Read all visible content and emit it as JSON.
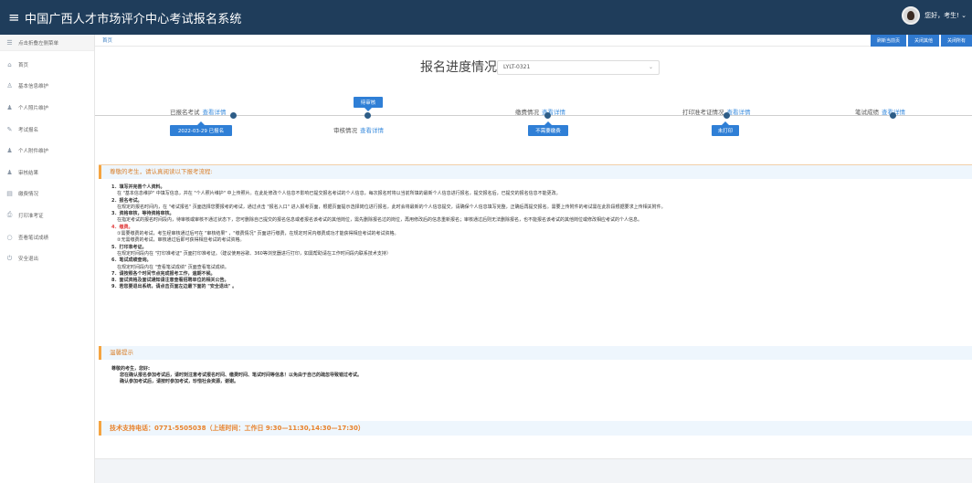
{
  "app": {
    "title": "中国广西人才市场评介中心考试报名系统",
    "menu_icon": "hamburger-icon"
  },
  "user": {
    "greeting": "您好，考生! ⌄"
  },
  "sidebar": {
    "items": [
      {
        "label": "点击折叠左侧菜单",
        "icon": "menu-icon",
        "glyph": "☰"
      },
      {
        "label": "首页",
        "icon": "home-icon",
        "glyph": "⌂"
      },
      {
        "label": "基本信息维护",
        "icon": "user-icon",
        "glyph": "♙"
      },
      {
        "label": "个人照片维护",
        "icon": "person-icon",
        "glyph": "♟"
      },
      {
        "label": "考试报名",
        "icon": "edit-icon",
        "glyph": "✎"
      },
      {
        "label": "个人附件维护",
        "icon": "attachment-icon",
        "glyph": "♟"
      },
      {
        "label": "审核结果",
        "icon": "review-icon",
        "glyph": "♟"
      },
      {
        "label": "缴费情况",
        "icon": "payment-icon",
        "glyph": "▤"
      },
      {
        "label": "打印准考证",
        "icon": "print-icon",
        "glyph": "⎙"
      },
      {
        "label": "查看笔试成绩",
        "icon": "search-icon",
        "glyph": "○"
      },
      {
        "label": "安全退出",
        "icon": "power-icon",
        "glyph": "⏻"
      }
    ]
  },
  "tabs": {
    "home": "首页",
    "buttons": [
      "刷新当前页",
      "关闭其他",
      "关闭所有"
    ]
  },
  "progress": {
    "title": "报名进度情况",
    "selected_exam": "LYLT-0321",
    "steps": [
      {
        "label": "已报名考试",
        "link": "查看详情",
        "pill": "2022-03-29 已报名"
      },
      {
        "label": "审核情况",
        "link": "查看详情",
        "pill": "待审核"
      },
      {
        "label": "缴费情况",
        "link": "查看详情",
        "pill": "不需要缴费"
      },
      {
        "label": "打印准考证情况",
        "link": "查看详情",
        "pill": "未打印"
      },
      {
        "label": "笔试成绩",
        "link": "查看详情"
      }
    ]
  },
  "notice": {
    "title": "尊敬的考生，请认真阅读以下报考流程:",
    "lines": [
      {
        "type": "st",
        "text": "1．填写并完善个人资料。"
      },
      {
        "type": "ln",
        "text": "在 \"基本信息维护\" 中填写信息，并在 \"个人照片维护\" 中上传照片。在此处修改个人信息不影响已提交报名考试的个人信息，每次报名时将以当前所填的最新个人信息进行报名，提交报名后，已提交的报名信息不能更改。"
      },
      {
        "type": "st",
        "text": "2．报名考试。"
      },
      {
        "type": "ln",
        "text": "在规定的报名时间内，在 \"考试报名\" 页面选择您要报考的考试，通过点击 \"报名入口\" 进入报考页面，根据页面提示选择岗位进行报名，此时会将最新的个人信息提交，请确保个人信息填写完整，正确后再提交报名。需要上传附件的考试需在此阶段根据要求上传相关附件。"
      },
      {
        "type": "st",
        "text": "3．资格审核，等待资格审核。"
      },
      {
        "type": "ln",
        "text": "在指定考试的报名时间段内，待审核或审核不通过状态下，您可删除自己提交的报名信息或者报名该考试的其他岗位，需先删除报名过的岗位，再用修改后的信息重新报名；审核通过后则无法删除报名，也不能报名该考试的其他岗位或修改相应考试的个人信息。"
      },
      {
        "type": "st red",
        "text": "4．缴费。"
      },
      {
        "type": "ln",
        "text": "①需要缴费的考试，考生经审核通过后可在 \"审核结果\" ，\"缴费情况\" 页面进行缴费，在规定时间内缴费成功才能获得相应考试的考试资格。"
      },
      {
        "type": "ln",
        "text": "②无需缴费的考试，审核通过后即可获得相应考试的考试资格。"
      },
      {
        "type": "st",
        "text": "5．打印准考证。"
      },
      {
        "type": "ln",
        "text": "在规定时间段内在 \"打印准考证\" 页面打印准考证。（建议使用谷歌、360等浏览器进行打印，如需帮助请在工作时间段内联系技术支持）"
      },
      {
        "type": "st",
        "text": "6．笔试成绩查询。"
      },
      {
        "type": "ln",
        "text": "在规定时间段内在 \"查看笔试成绩\" 页面查看笔试成绩。"
      },
      {
        "type": "st",
        "text": "7．请按照各个时间节点完成报考工作，逾期不候。"
      },
      {
        "type": "st",
        "text": "8．面试资格及面试通知请注意查看招聘单位的相关公告。"
      },
      {
        "type": "st",
        "text": "9．若您要退出系统，请点击页面左边最下面的 \"安全退出\" 。"
      }
    ]
  },
  "tips": {
    "title": "温馨提示",
    "salutation": "尊敬的考生，您好:",
    "line1": "您在确认报名参加考试后，请时刻注意考试报名时间、缴费时间、笔试时间等信息！以免由于自己的疏忽导致错过考试。",
    "line2": "确认参加考试后，请按时参加考试，珍惜社会资源，谢谢。"
  },
  "support": {
    "text": "技术支持电话：0771-5505038（上班时间：工作日 9:30—11:30,14:30—17:30）"
  }
}
